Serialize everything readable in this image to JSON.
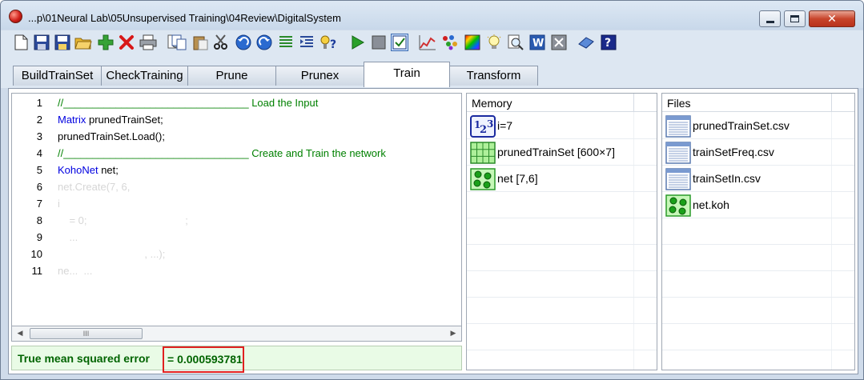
{
  "window": {
    "title": "...p\\01Neural Lab\\05Unsupervised Training\\04Review\\DigitalSystem",
    "close_glyph": "✕"
  },
  "toolbar": {
    "icons": [
      "new-document",
      "save",
      "save-as",
      "open-folder",
      "add",
      "delete",
      "print",
      "print-preview",
      "copy",
      "paste",
      "cut",
      "undo",
      "redo",
      "align-left",
      "indent",
      "find-help",
      "run",
      "stop",
      "check",
      "chart",
      "scatter",
      "palette",
      "idea",
      "zoom",
      "word",
      "excel",
      "book",
      "help"
    ]
  },
  "tabs": [
    {
      "label": "BuildTrainSet"
    },
    {
      "label": "CheckTraining"
    },
    {
      "label": "Prune"
    },
    {
      "label": "Prunex"
    },
    {
      "label": "Train"
    },
    {
      "label": "Transform"
    }
  ],
  "active_tab": "Train",
  "editor": {
    "lines": [
      {
        "n": "1",
        "parts": [
          {
            "t": "//________________________________ Load the Input",
            "c": "comment"
          }
        ]
      },
      {
        "n": "2",
        "parts": [
          {
            "t": "Matrix",
            "c": "kw"
          },
          {
            "t": " prunedTrainSet;",
            "c": ""
          }
        ]
      },
      {
        "n": "3",
        "parts": [
          {
            "t": "prunedTrainSet.Load();",
            "c": ""
          }
        ]
      },
      {
        "n": "4",
        "parts": [
          {
            "t": "//________________________________ Create and Train the network",
            "c": "comment"
          }
        ]
      },
      {
        "n": "5",
        "parts": [
          {
            "t": "KohoNet",
            "c": "kw"
          },
          {
            "t": " net;",
            "c": ""
          }
        ]
      },
      {
        "n": "6",
        "parts": [
          {
            "t": "net.Create(7, 6,",
            "c": "faded"
          }
        ]
      },
      {
        "n": "7",
        "parts": [
          {
            "t": "i",
            "c": "faded"
          }
        ]
      },
      {
        "n": "8",
        "parts": [
          {
            "t": "    = 0;                                  ;",
            "c": "faded"
          }
        ]
      },
      {
        "n": "9",
        "parts": [
          {
            "t": "    ...",
            "c": "faded"
          }
        ]
      },
      {
        "n": "10",
        "parts": [
          {
            "t": "                              , ...);",
            "c": "faded"
          }
        ]
      },
      {
        "n": "11",
        "parts": [
          {
            "t": "ne...  ...",
            "c": "faded"
          }
        ]
      }
    ],
    "scroll_thumb": "III"
  },
  "status": {
    "label": "True mean squared error",
    "value": "= 0.000593781"
  },
  "memory": {
    "header": "Memory",
    "items": [
      {
        "icon": "integer-icon",
        "label": "i=7"
      },
      {
        "icon": "matrix-icon",
        "label": "prunedTrainSet [600×7]"
      },
      {
        "icon": "network-icon",
        "label": "net [7,6]"
      }
    ]
  },
  "files": {
    "header": "Files",
    "items": [
      {
        "icon": "csv-file-icon",
        "label": "prunedTrainSet.csv"
      },
      {
        "icon": "csv-file-icon",
        "label": "trainSetFreq.csv"
      },
      {
        "icon": "csv-file-icon",
        "label": "trainSetIn.csv"
      },
      {
        "icon": "network-icon",
        "label": "net.koh"
      }
    ]
  },
  "colors": {
    "comment": "#008000",
    "keyword": "#0000e0",
    "status_text": "#006400",
    "status_bg": "#e9fbe6",
    "highlight_box": "#e02020"
  }
}
